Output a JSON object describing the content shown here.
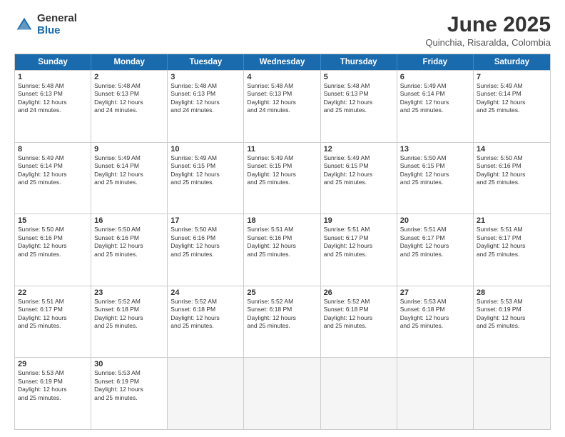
{
  "logo": {
    "general": "General",
    "blue": "Blue"
  },
  "title": "June 2025",
  "location": "Quinchia, Risaralda, Colombia",
  "header_days": [
    "Sunday",
    "Monday",
    "Tuesday",
    "Wednesday",
    "Thursday",
    "Friday",
    "Saturday"
  ],
  "rows": [
    [
      {
        "day": "1",
        "lines": [
          "Sunrise: 5:48 AM",
          "Sunset: 6:13 PM",
          "Daylight: 12 hours",
          "and 24 minutes."
        ]
      },
      {
        "day": "2",
        "lines": [
          "Sunrise: 5:48 AM",
          "Sunset: 6:13 PM",
          "Daylight: 12 hours",
          "and 24 minutes."
        ]
      },
      {
        "day": "3",
        "lines": [
          "Sunrise: 5:48 AM",
          "Sunset: 6:13 PM",
          "Daylight: 12 hours",
          "and 24 minutes."
        ]
      },
      {
        "day": "4",
        "lines": [
          "Sunrise: 5:48 AM",
          "Sunset: 6:13 PM",
          "Daylight: 12 hours",
          "and 24 minutes."
        ]
      },
      {
        "day": "5",
        "lines": [
          "Sunrise: 5:48 AM",
          "Sunset: 6:13 PM",
          "Daylight: 12 hours",
          "and 25 minutes."
        ]
      },
      {
        "day": "6",
        "lines": [
          "Sunrise: 5:49 AM",
          "Sunset: 6:14 PM",
          "Daylight: 12 hours",
          "and 25 minutes."
        ]
      },
      {
        "day": "7",
        "lines": [
          "Sunrise: 5:49 AM",
          "Sunset: 6:14 PM",
          "Daylight: 12 hours",
          "and 25 minutes."
        ]
      }
    ],
    [
      {
        "day": "8",
        "lines": [
          "Sunrise: 5:49 AM",
          "Sunset: 6:14 PM",
          "Daylight: 12 hours",
          "and 25 minutes."
        ]
      },
      {
        "day": "9",
        "lines": [
          "Sunrise: 5:49 AM",
          "Sunset: 6:14 PM",
          "Daylight: 12 hours",
          "and 25 minutes."
        ]
      },
      {
        "day": "10",
        "lines": [
          "Sunrise: 5:49 AM",
          "Sunset: 6:15 PM",
          "Daylight: 12 hours",
          "and 25 minutes."
        ]
      },
      {
        "day": "11",
        "lines": [
          "Sunrise: 5:49 AM",
          "Sunset: 6:15 PM",
          "Daylight: 12 hours",
          "and 25 minutes."
        ]
      },
      {
        "day": "12",
        "lines": [
          "Sunrise: 5:49 AM",
          "Sunset: 6:15 PM",
          "Daylight: 12 hours",
          "and 25 minutes."
        ]
      },
      {
        "day": "13",
        "lines": [
          "Sunrise: 5:50 AM",
          "Sunset: 6:15 PM",
          "Daylight: 12 hours",
          "and 25 minutes."
        ]
      },
      {
        "day": "14",
        "lines": [
          "Sunrise: 5:50 AM",
          "Sunset: 6:16 PM",
          "Daylight: 12 hours",
          "and 25 minutes."
        ]
      }
    ],
    [
      {
        "day": "15",
        "lines": [
          "Sunrise: 5:50 AM",
          "Sunset: 6:16 PM",
          "Daylight: 12 hours",
          "and 25 minutes."
        ]
      },
      {
        "day": "16",
        "lines": [
          "Sunrise: 5:50 AM",
          "Sunset: 6:16 PM",
          "Daylight: 12 hours",
          "and 25 minutes."
        ]
      },
      {
        "day": "17",
        "lines": [
          "Sunrise: 5:50 AM",
          "Sunset: 6:16 PM",
          "Daylight: 12 hours",
          "and 25 minutes."
        ]
      },
      {
        "day": "18",
        "lines": [
          "Sunrise: 5:51 AM",
          "Sunset: 6:16 PM",
          "Daylight: 12 hours",
          "and 25 minutes."
        ]
      },
      {
        "day": "19",
        "lines": [
          "Sunrise: 5:51 AM",
          "Sunset: 6:17 PM",
          "Daylight: 12 hours",
          "and 25 minutes."
        ]
      },
      {
        "day": "20",
        "lines": [
          "Sunrise: 5:51 AM",
          "Sunset: 6:17 PM",
          "Daylight: 12 hours",
          "and 25 minutes."
        ]
      },
      {
        "day": "21",
        "lines": [
          "Sunrise: 5:51 AM",
          "Sunset: 6:17 PM",
          "Daylight: 12 hours",
          "and 25 minutes."
        ]
      }
    ],
    [
      {
        "day": "22",
        "lines": [
          "Sunrise: 5:51 AM",
          "Sunset: 6:17 PM",
          "Daylight: 12 hours",
          "and 25 minutes."
        ]
      },
      {
        "day": "23",
        "lines": [
          "Sunrise: 5:52 AM",
          "Sunset: 6:18 PM",
          "Daylight: 12 hours",
          "and 25 minutes."
        ]
      },
      {
        "day": "24",
        "lines": [
          "Sunrise: 5:52 AM",
          "Sunset: 6:18 PM",
          "Daylight: 12 hours",
          "and 25 minutes."
        ]
      },
      {
        "day": "25",
        "lines": [
          "Sunrise: 5:52 AM",
          "Sunset: 6:18 PM",
          "Daylight: 12 hours",
          "and 25 minutes."
        ]
      },
      {
        "day": "26",
        "lines": [
          "Sunrise: 5:52 AM",
          "Sunset: 6:18 PM",
          "Daylight: 12 hours",
          "and 25 minutes."
        ]
      },
      {
        "day": "27",
        "lines": [
          "Sunrise: 5:53 AM",
          "Sunset: 6:18 PM",
          "Daylight: 12 hours",
          "and 25 minutes."
        ]
      },
      {
        "day": "28",
        "lines": [
          "Sunrise: 5:53 AM",
          "Sunset: 6:19 PM",
          "Daylight: 12 hours",
          "and 25 minutes."
        ]
      }
    ],
    [
      {
        "day": "29",
        "lines": [
          "Sunrise: 5:53 AM",
          "Sunset: 6:19 PM",
          "Daylight: 12 hours",
          "and 25 minutes."
        ]
      },
      {
        "day": "30",
        "lines": [
          "Sunrise: 5:53 AM",
          "Sunset: 6:19 PM",
          "Daylight: 12 hours",
          "and 25 minutes."
        ]
      },
      {
        "day": "",
        "lines": []
      },
      {
        "day": "",
        "lines": []
      },
      {
        "day": "",
        "lines": []
      },
      {
        "day": "",
        "lines": []
      },
      {
        "day": "",
        "lines": []
      }
    ]
  ]
}
